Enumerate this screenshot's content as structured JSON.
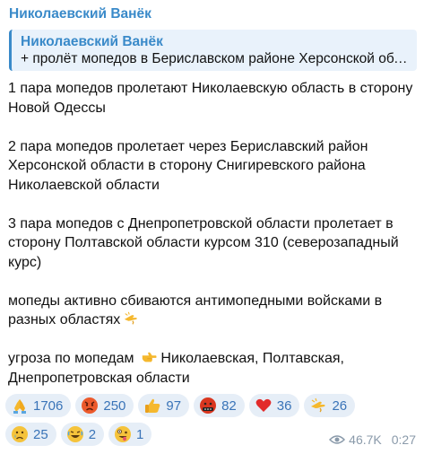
{
  "message": {
    "sender": "Николаевский Ванёк",
    "reply": {
      "author": "Николаевский Ванёк",
      "text": "+ пролёт мопедов в Бериславском районе Херсонской области"
    },
    "paragraphs": [
      "1 пара мопедов пролетают Николаевскую область в сторону Новой Одессы",
      "2 пара мопедов пролетает через Бериславский район Херсонской области в сторону Снигиревского района Николаевской области",
      "3 пара мопедов с Днепропетровской области пролетает в сторону Полтавской области курсом 310 (северозападный курс)",
      "мопеды активно сбиваются антимопедными войсками в разных областях",
      "угроза по мопедам",
      "Николаевская, Полтавская, Днепропетровская области"
    ],
    "inline_emojis": {
      "salute": "saluting-hand-icon",
      "pointing": "pointing-right-icon"
    },
    "reactions": [
      {
        "icon": "folded-hands-icon",
        "count": "1706"
      },
      {
        "icon": "angry-face-icon",
        "count": "250"
      },
      {
        "icon": "thumbs-up-icon",
        "count": "97"
      },
      {
        "icon": "cursing-face-icon",
        "count": "82"
      },
      {
        "icon": "red-heart-icon",
        "count": "36"
      },
      {
        "icon": "saluting-hand-icon",
        "count": "26"
      },
      {
        "icon": "crying-face-icon",
        "count": "25"
      },
      {
        "icon": "rofl-face-icon",
        "count": "2"
      },
      {
        "icon": "zany-face-icon",
        "count": "1"
      }
    ],
    "views": "46.7K",
    "time": "0:27"
  },
  "colors": {
    "accent": "#3a8ac9",
    "reply_bg": "#e9f2fb",
    "chip_bg": "#e6eef7",
    "meta": "#8a9aaa"
  }
}
